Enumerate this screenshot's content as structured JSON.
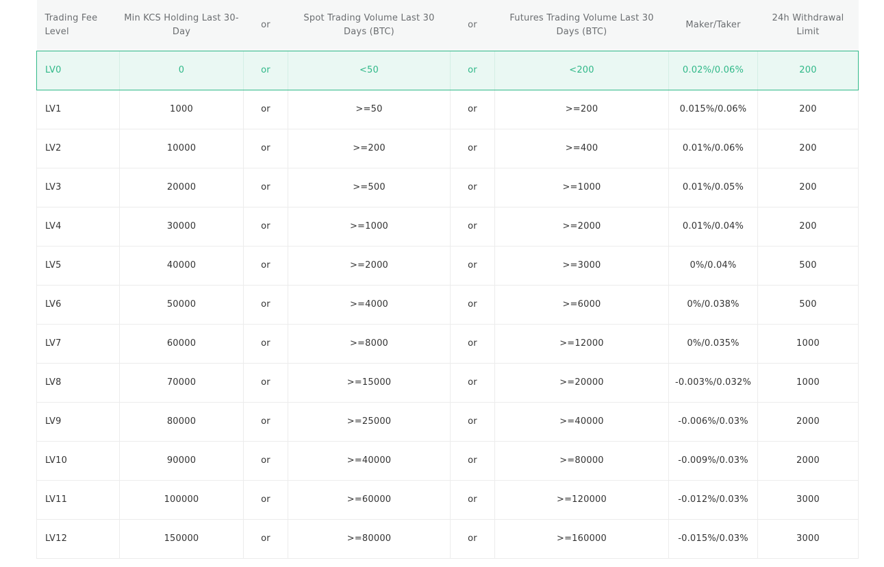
{
  "colors": {
    "accent": "#2fb888",
    "header_bg": "#f6f7f7",
    "highlight_bg": "#eaf8f3"
  },
  "headers": {
    "level": "Trading Fee Level",
    "kcs": "Min KCS Holding Last 30-Day",
    "or1": "or",
    "spot": "Spot Trading Volume Last 30 Days (BTC)",
    "or2": "or",
    "futures": "Futures Trading Volume Last 30 Days (BTC)",
    "maker_taker": "Maker/Taker",
    "withdrawal": "24h Withdrawal Limit"
  },
  "rows": [
    {
      "level": "LV0",
      "kcs": "0",
      "or1": "or",
      "spot": "<50",
      "or2": "or",
      "futures": "<200",
      "maker_taker": "0.02%/0.06%",
      "withdrawal": "200"
    },
    {
      "level": "LV1",
      "kcs": "1000",
      "or1": "or",
      "spot": ">=50",
      "or2": "or",
      "futures": ">=200",
      "maker_taker": "0.015%/0.06%",
      "withdrawal": "200"
    },
    {
      "level": "LV2",
      "kcs": "10000",
      "or1": "or",
      "spot": ">=200",
      "or2": "or",
      "futures": ">=400",
      "maker_taker": "0.01%/0.06%",
      "withdrawal": "200"
    },
    {
      "level": "LV3",
      "kcs": "20000",
      "or1": "or",
      "spot": ">=500",
      "or2": "or",
      "futures": ">=1000",
      "maker_taker": "0.01%/0.05%",
      "withdrawal": "200"
    },
    {
      "level": "LV4",
      "kcs": "30000",
      "or1": "or",
      "spot": ">=1000",
      "or2": "or",
      "futures": ">=2000",
      "maker_taker": "0.01%/0.04%",
      "withdrawal": "200"
    },
    {
      "level": "LV5",
      "kcs": "40000",
      "or1": "or",
      "spot": ">=2000",
      "or2": "or",
      "futures": ">=3000",
      "maker_taker": "0%/0.04%",
      "withdrawal": "500"
    },
    {
      "level": "LV6",
      "kcs": "50000",
      "or1": "or",
      "spot": ">=4000",
      "or2": "or",
      "futures": ">=6000",
      "maker_taker": "0%/0.038%",
      "withdrawal": "500"
    },
    {
      "level": "LV7",
      "kcs": "60000",
      "or1": "or",
      "spot": ">=8000",
      "or2": "or",
      "futures": ">=12000",
      "maker_taker": "0%/0.035%",
      "withdrawal": "1000"
    },
    {
      "level": "LV8",
      "kcs": "70000",
      "or1": "or",
      "spot": ">=15000",
      "or2": "or",
      "futures": ">=20000",
      "maker_taker": "-0.003%/0.032%",
      "withdrawal": "1000"
    },
    {
      "level": "LV9",
      "kcs": "80000",
      "or1": "or",
      "spot": ">=25000",
      "or2": "or",
      "futures": ">=40000",
      "maker_taker": "-0.006%/0.03%",
      "withdrawal": "2000"
    },
    {
      "level": "LV10",
      "kcs": "90000",
      "or1": "or",
      "spot": ">=40000",
      "or2": "or",
      "futures": ">=80000",
      "maker_taker": "-0.009%/0.03%",
      "withdrawal": "2000"
    },
    {
      "level": "LV11",
      "kcs": "100000",
      "or1": "or",
      "spot": ">=60000",
      "or2": "or",
      "futures": ">=120000",
      "maker_taker": "-0.012%/0.03%",
      "withdrawal": "3000"
    },
    {
      "level": "LV12",
      "kcs": "150000",
      "or1": "or",
      "spot": ">=80000",
      "or2": "or",
      "futures": ">=160000",
      "maker_taker": "-0.015%/0.03%",
      "withdrawal": "3000"
    }
  ]
}
